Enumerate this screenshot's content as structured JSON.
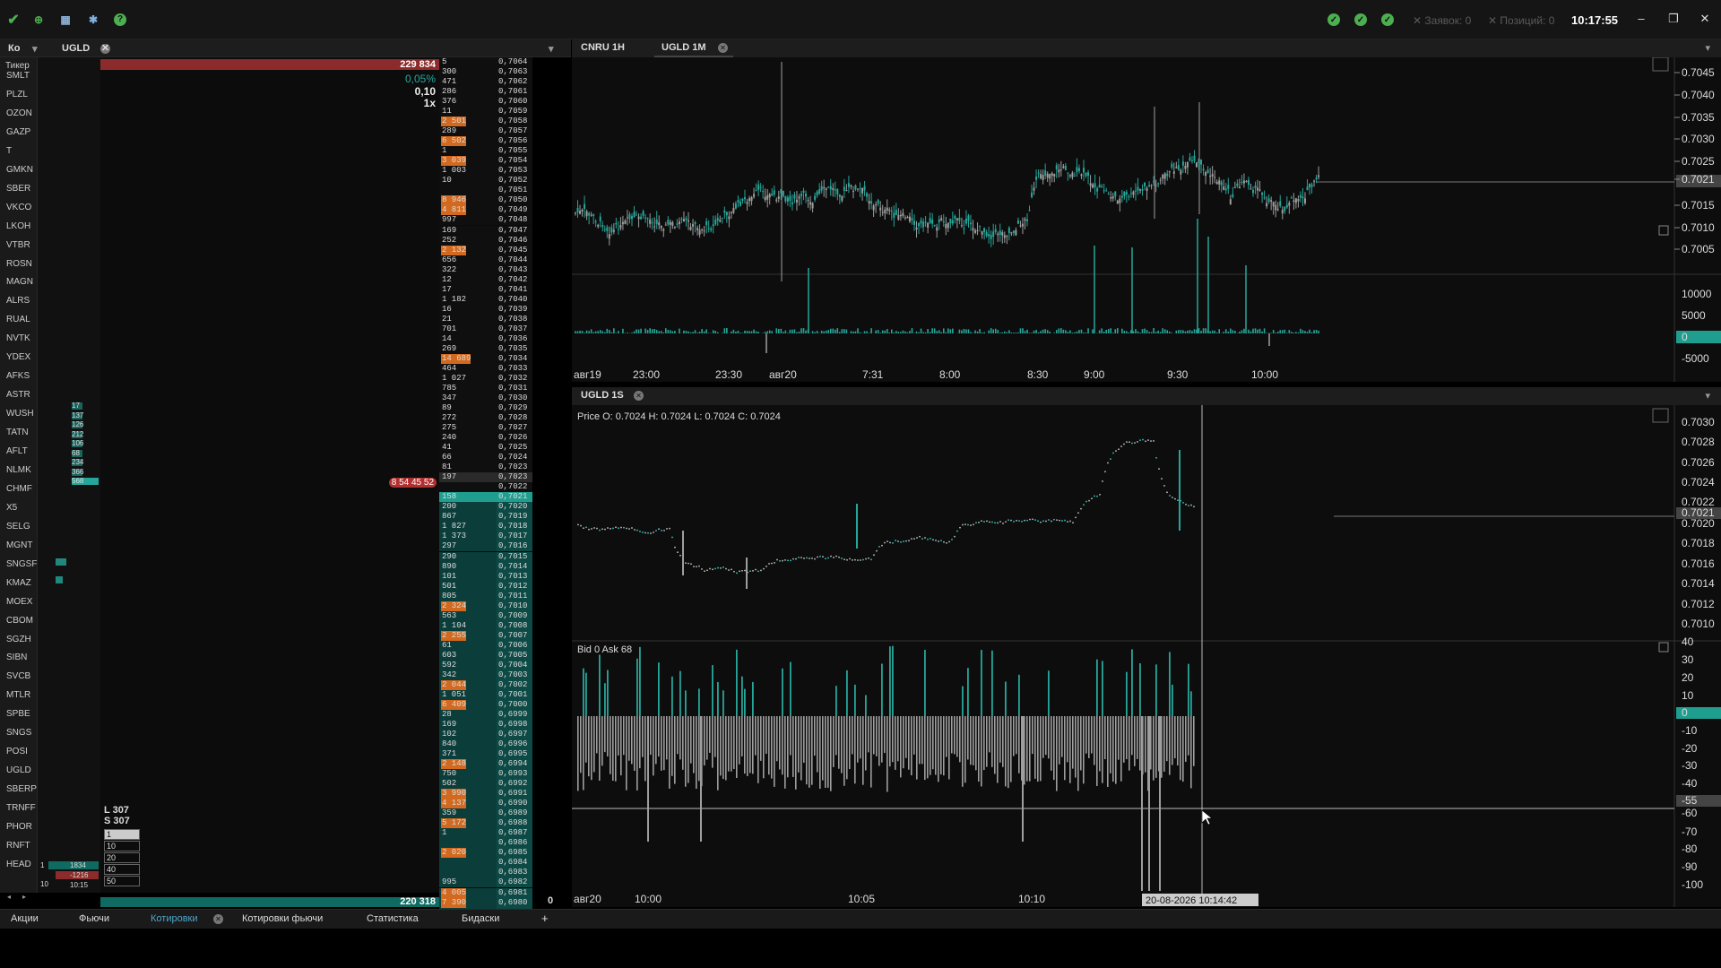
{
  "topbar": {
    "icons": [
      "logo-icon",
      "plus-icon",
      "table-icon",
      "gear-icon",
      "help-icon"
    ],
    "orders_label": "Заявок: 0",
    "positions_label": "Позиций: 0",
    "clock": "10:17:55"
  },
  "left_header": {
    "ko_label": "Ко",
    "tab_label": "UGLD",
    "ticker_header": "Тикер"
  },
  "tickers": [
    "SMLT",
    "PLZL",
    "OZON",
    "GAZP",
    "T",
    "GMKN",
    "SBER",
    "VKCO",
    "LKOH",
    "VTBR",
    "ROSN",
    "MAGN",
    "ALRS",
    "RUAL",
    "NVTK",
    "YDEX",
    "AFKS",
    "ASTR",
    "WUSH",
    "TATN",
    "AFLT",
    "NLMK",
    "CHMF",
    "X5",
    "SELG",
    "MGNT",
    "SNGSF",
    "KMAZ",
    "MOEX",
    "CBOM",
    "SGZH",
    "SIBN",
    "SVCB",
    "MTLR",
    "SPBE",
    "SNGS",
    "POSI",
    "UGLD",
    "SBERP",
    "TRNFF",
    "PHOR",
    "RNFT",
    "HEAD"
  ],
  "minibars": {
    "values": [
      "17",
      "137",
      "126",
      "212",
      "106",
      "68",
      "234",
      "366",
      "568"
    ],
    "bottom": [
      "1834",
      "-1216",
      "10:15"
    ],
    "bottom_left": [
      "1",
      "10"
    ]
  },
  "orderbook": {
    "top_volume": "229 834",
    "change_pct": "0,05%",
    "step": "0,10",
    "leverage": "1x",
    "last_marker": "8 54 45 52",
    "bottom_volume": "220 318",
    "ls": [
      "L 307",
      "S 307"
    ],
    "qty_options": [
      "1",
      "10",
      "20",
      "40",
      "50"
    ],
    "zero_label": "0"
  },
  "ladder": [
    [
      "5",
      "0,7064"
    ],
    [
      "300",
      "0,7063"
    ],
    [
      "471",
      "0,7062"
    ],
    [
      "286",
      "0,7061"
    ],
    [
      "376",
      "0,7060"
    ],
    [
      "11",
      "0,7059"
    ],
    [
      "2 501",
      "0,7058"
    ],
    [
      "289",
      "0,7057"
    ],
    [
      "6 502",
      "0,7056"
    ],
    [
      "1",
      "0,7055"
    ],
    [
      "3 039",
      "0,7054"
    ],
    [
      "1 003",
      "0,7053"
    ],
    [
      "10",
      "0,7052"
    ],
    [
      "",
      "0,7051"
    ],
    [
      "8 946",
      "0,7050"
    ],
    [
      "4 811",
      "0,7049"
    ],
    [
      "997",
      "0,7048"
    ],
    [
      "169",
      "0,7047"
    ],
    [
      "252",
      "0,7046"
    ],
    [
      "2 132",
      "0,7045"
    ],
    [
      "656",
      "0,7044"
    ],
    [
      "322",
      "0,7043"
    ],
    [
      "12",
      "0,7042"
    ],
    [
      "17",
      "0,7041"
    ],
    [
      "1 182",
      "0,7040"
    ],
    [
      "16",
      "0,7039"
    ],
    [
      "21",
      "0,7038"
    ],
    [
      "701",
      "0,7037"
    ],
    [
      "14",
      "0,7036"
    ],
    [
      "269",
      "0,7035"
    ],
    [
      "14 689",
      "0,7034"
    ],
    [
      "464",
      "0,7033"
    ],
    [
      "1 027",
      "0,7032"
    ],
    [
      "785",
      "0,7031"
    ],
    [
      "347",
      "0,7030"
    ],
    [
      "89",
      "0,7029"
    ],
    [
      "272",
      "0,7028"
    ],
    [
      "275",
      "0,7027"
    ],
    [
      "240",
      "0,7026"
    ],
    [
      "41",
      "0,7025"
    ],
    [
      "66",
      "0,7024"
    ],
    [
      "81",
      "0,7023"
    ],
    [
      "197",
      "0,7023"
    ],
    [
      "",
      "0,7022"
    ],
    [
      "158",
      "0,7021"
    ],
    [
      "200",
      "0,7020"
    ],
    [
      "867",
      "0,7019"
    ],
    [
      "1 827",
      "0,7018"
    ],
    [
      "1 373",
      "0,7017"
    ],
    [
      "297",
      "0,7016"
    ],
    [
      "290",
      "0,7015"
    ],
    [
      "890",
      "0,7014"
    ],
    [
      "101",
      "0,7013"
    ],
    [
      "501",
      "0,7012"
    ],
    [
      "805",
      "0,7011"
    ],
    [
      "2 324",
      "0,7010"
    ],
    [
      "563",
      "0,7009"
    ],
    [
      "1 104",
      "0,7008"
    ],
    [
      "2 255",
      "0,7007"
    ],
    [
      "61",
      "0,7006"
    ],
    [
      "603",
      "0,7005"
    ],
    [
      "592",
      "0,7004"
    ],
    [
      "342",
      "0,7003"
    ],
    [
      "2 044",
      "0,7002"
    ],
    [
      "1 051",
      "0,7001"
    ],
    [
      "6 409",
      "0,7000"
    ],
    [
      "28",
      "0,6999"
    ],
    [
      "169",
      "0,6998"
    ],
    [
      "102",
      "0,6997"
    ],
    [
      "840",
      "0,6996"
    ],
    [
      "371",
      "0,6995"
    ],
    [
      "2 148",
      "0,6994"
    ],
    [
      "750",
      "0,6993"
    ],
    [
      "502",
      "0,6992"
    ],
    [
      "3 990",
      "0,6991"
    ],
    [
      "4 137",
      "0,6990"
    ],
    [
      "359",
      "0,6989"
    ],
    [
      "5 172",
      "0,6988"
    ],
    [
      "1",
      "0,6987"
    ],
    [
      "",
      "0,6986"
    ],
    [
      "2 020",
      "0,6985"
    ],
    [
      "",
      "0,6984"
    ],
    [
      "",
      "0,6983"
    ],
    [
      "995",
      "0,6982"
    ],
    [
      "4 005",
      "0,6981"
    ],
    [
      "7 390",
      "0,6980"
    ],
    [
      "482",
      "0,6979"
    ]
  ],
  "chart_top": {
    "tabs": [
      "CNRU 1H",
      "UGLD 1M"
    ],
    "price_axis": [
      "0.7045",
      "0.7040",
      "0.7035",
      "0.7030",
      "0.7025",
      "0.7021",
      "0.7015",
      "0.7010",
      "0.7005"
    ],
    "volume_axis": [
      "10000",
      "5000",
      "0",
      "-5000"
    ],
    "time_axis": [
      "авг19",
      "23:00",
      "23:30",
      "авг20",
      "7:31",
      "8:00",
      "8:30",
      "9:00",
      "9:30",
      "10:00"
    ],
    "last_price": "0.7021"
  },
  "chart_bottom": {
    "tab": "UGLD 1S",
    "ohlc": "Price O: 0.7024 H: 0.7024 L: 0.7024 C: 0.7024",
    "bidask": "Bid 0 Ask 68",
    "price_axis": [
      "0.7030",
      "0.7028",
      "0.7026",
      "0.7024",
      "0.7022",
      "0.7021",
      "0.7020",
      "0.7018",
      "0.7016",
      "0.7014",
      "0.7012",
      "0.7010"
    ],
    "delta_axis": [
      "40",
      "30",
      "20",
      "10",
      "0",
      "-10",
      "-20",
      "-30",
      "-40",
      "-55",
      "-60",
      "-70",
      "-80",
      "-90",
      "-100"
    ],
    "time_axis": [
      "авг20",
      "10:00",
      "10:05",
      "10:10"
    ],
    "cursor_time": "20-08-2026 10:14:42"
  },
  "bottom_tabs": [
    "Акции",
    "Фьючи",
    "Котировки",
    "Котировки фьючи",
    "Статистика",
    "Бидаски",
    "+"
  ],
  "colors": {
    "teal": "#26a69a",
    "red": "#c0392b",
    "orange": "#e67e22",
    "green": "#4caf50"
  }
}
